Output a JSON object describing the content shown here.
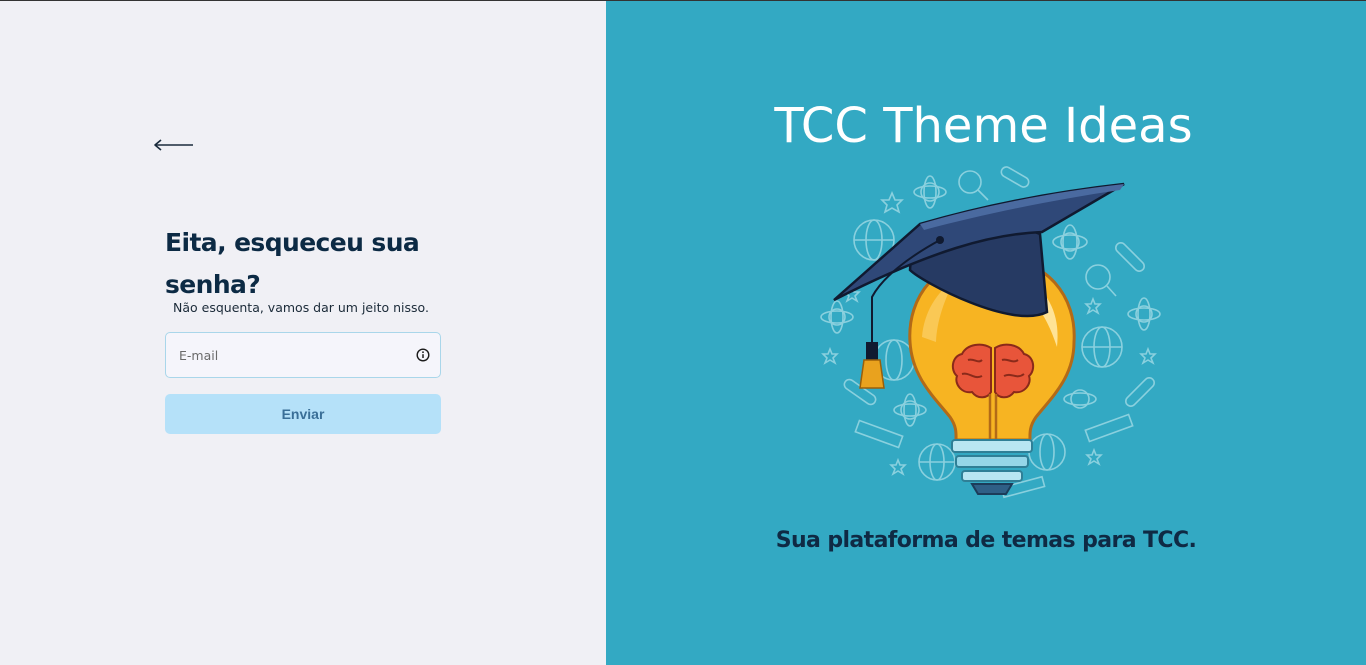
{
  "left": {
    "back_icon": "arrow-left-icon",
    "heading": "Eita, esqueceu sua senha?",
    "subtitle": "Não esquenta, vamos dar um jeito nisso.",
    "email_field": {
      "placeholder": "E-mail",
      "value": "",
      "icon": "info-icon"
    },
    "submit_label": "Enviar"
  },
  "right": {
    "title": "TCC Theme Ideas",
    "illustration": "lightbulb-brain-graduation-cap",
    "tagline": "Sua plataforma de temas para TCC."
  },
  "colors": {
    "left_background": "#f0f0f5",
    "right_background": "#33a9c3",
    "button_background": "#b5e1f9",
    "heading_text": "#0c2a44"
  }
}
